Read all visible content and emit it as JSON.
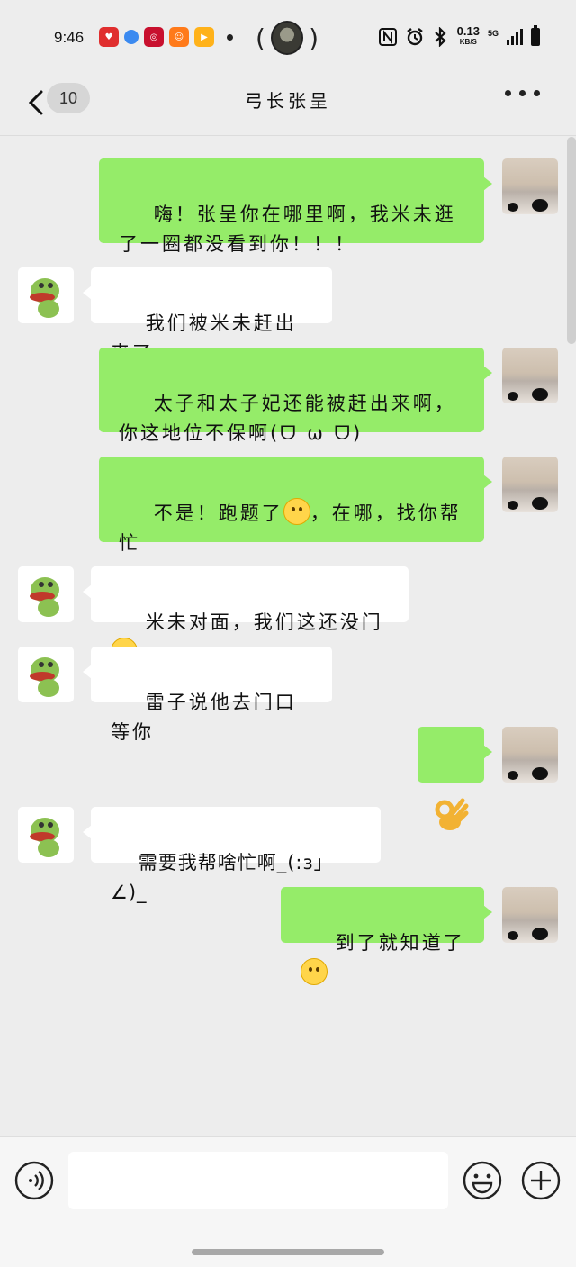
{
  "status_bar": {
    "time": "9:46",
    "network_speed_value": "0.13",
    "network_speed_unit": "KB/S",
    "network_type": "5G",
    "icons": [
      "nfc-icon",
      "alarm-icon",
      "bluetooth-icon",
      "signal-icon",
      "battery-icon"
    ]
  },
  "header": {
    "back_count": "10",
    "title": "弓长张呈",
    "more_icon": "more-dots-icon"
  },
  "messages": [
    {
      "side": "me",
      "text": "嗨！张呈你在哪里啊，我米未逛了一圈都没看到你！！！"
    },
    {
      "side": "them",
      "text": "我们被米未赶出来了"
    },
    {
      "side": "me",
      "text": "太子和太子妃还能被赶出来啊，你这地位不保啊(ᗜ ω ᗜ)"
    },
    {
      "side": "me",
      "text_before": "不是！跑题了",
      "emoji": "smile-emoji",
      "text_after": "，在哪，找你帮忙"
    },
    {
      "side": "them",
      "text": "米未对面，我们这还没门",
      "emoji": "grimace-emoji"
    },
    {
      "side": "them",
      "text": "雷子说他去门口等你"
    },
    {
      "side": "me",
      "emoji": "ok-hand-emoji"
    },
    {
      "side": "them",
      "text": "需要我帮啥忙啊_(:з」∠)_"
    },
    {
      "side": "me",
      "text": "到了就知道了",
      "emoji": "grin-emoji"
    }
  ],
  "input_bar": {
    "voice_icon": "voice-icon",
    "emoji_icon": "emoji-icon",
    "plus_icon": "plus-icon",
    "text_value": ""
  },
  "colors": {
    "my_bubble": "#95ec69",
    "their_bubble": "#ffffff",
    "background": "#ededed"
  }
}
